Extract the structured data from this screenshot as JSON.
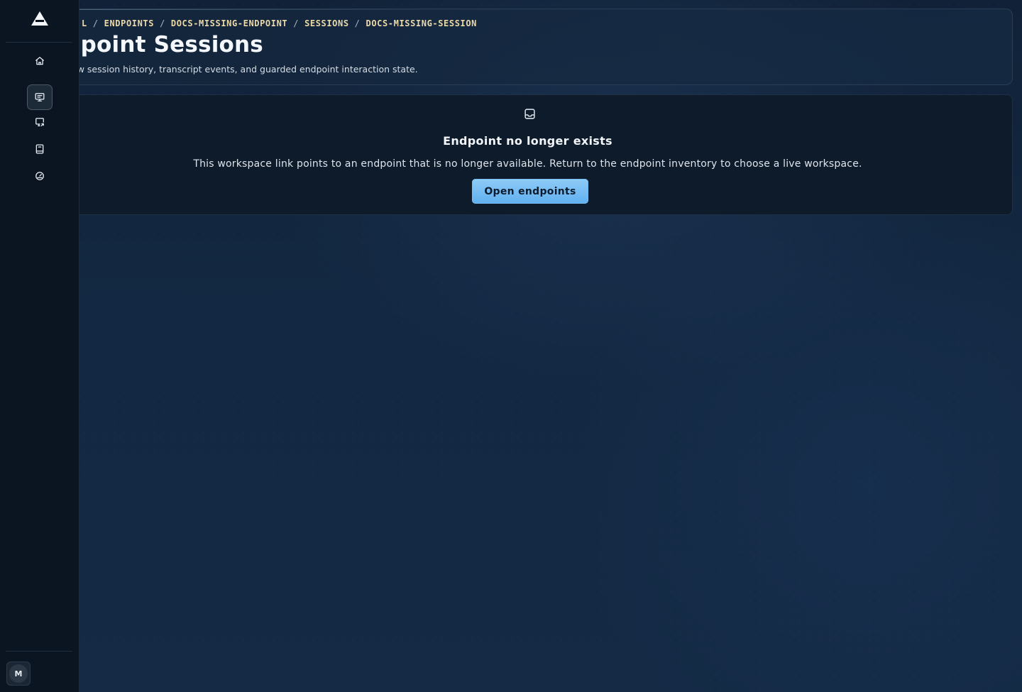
{
  "sidebar": {
    "logo": "app-logo",
    "nav": [
      {
        "name": "home",
        "icon": "home-icon",
        "active": false
      },
      {
        "name": "endpoints",
        "icon": "monitor-icon",
        "active": true
      },
      {
        "name": "remote-sessions",
        "icon": "monitor-share-icon",
        "active": false
      },
      {
        "name": "docs",
        "icon": "book-icon",
        "active": false
      },
      {
        "name": "dashboard",
        "icon": "gauge-icon",
        "active": false
      }
    ],
    "avatar_initial": "M"
  },
  "header": {
    "breadcrumb": {
      "partial_lead": "L",
      "items": [
        "ENDPOINTS",
        "DOCS-MISSING-ENDPOINT",
        "SESSIONS",
        "DOCS-MISSING-SESSION"
      ],
      "separator": "/"
    },
    "title": "ndpoint Sessions",
    "subtitle": "ew session history, transcript events, and guarded endpoint interaction state."
  },
  "empty_state": {
    "icon": "inbox-icon",
    "title": "Endpoint no longer exists",
    "description": "This workspace link points to an endpoint that is no longer available. Return to the endpoint inventory to choose a live workspace.",
    "button_label": "Open endpoints"
  },
  "colors": {
    "accent": "#6fb9f2",
    "breadcrumb": "#ecd9a8",
    "sidebar_bg": "#0b1522",
    "page_bg": "#132842"
  }
}
